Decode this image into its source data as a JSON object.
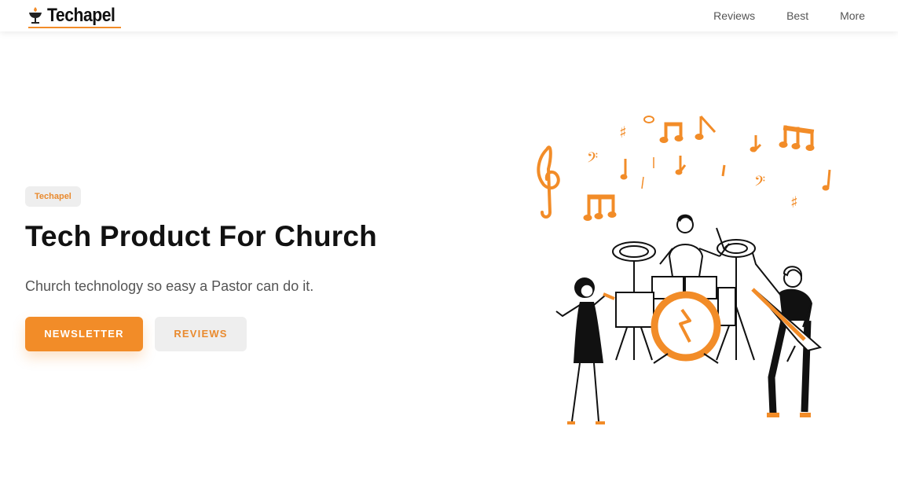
{
  "brand": {
    "name": "Techapel",
    "accent": "#f28c28"
  },
  "nav": {
    "links": [
      {
        "label": "Reviews"
      },
      {
        "label": "Best"
      },
      {
        "label": "More"
      }
    ]
  },
  "hero": {
    "badge": "Techapel",
    "title": "Tech Product For Church",
    "subtitle": "Church technology so easy a Pastor can do it.",
    "primary_button": "NEWSLETTER",
    "secondary_button": "REVIEWS"
  },
  "illustration": {
    "icon": "band-playing-music-illustration"
  }
}
